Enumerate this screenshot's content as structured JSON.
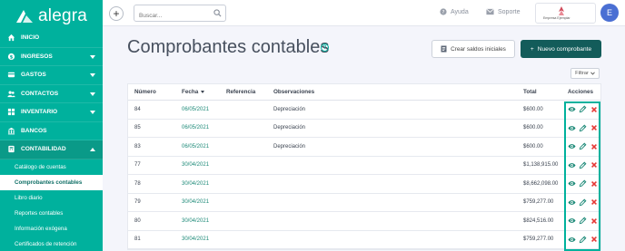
{
  "brand": {
    "name": "alegra"
  },
  "sidebar": {
    "items": [
      {
        "label": "INICIO",
        "icon": "home-icon",
        "has_chevron": false
      },
      {
        "label": "INGRESOS",
        "icon": "income-icon",
        "has_chevron": true
      },
      {
        "label": "GASTOS",
        "icon": "expense-icon",
        "has_chevron": true
      },
      {
        "label": "CONTACTOS",
        "icon": "contacts-icon",
        "has_chevron": true
      },
      {
        "label": "INVENTARIO",
        "icon": "inventory-icon",
        "has_chevron": true
      },
      {
        "label": "BANCOS",
        "icon": "bank-icon",
        "has_chevron": false
      },
      {
        "label": "CONTABILIDAD",
        "icon": "accounting-icon",
        "has_chevron": true,
        "open": true
      }
    ],
    "subitems": [
      {
        "label": "Catálogo de cuentas",
        "active": false
      },
      {
        "label": "Comprobantes contables",
        "active": true
      },
      {
        "label": "Libro diario",
        "active": false
      },
      {
        "label": "Reportes contables",
        "active": false
      },
      {
        "label": "Información exógena",
        "active": false
      },
      {
        "label": "Certificados de retención",
        "active": false
      }
    ]
  },
  "topbar": {
    "add_label": "+",
    "search_placeholder": "Buscar...",
    "help_label": "Ayuda",
    "support_label": "Soporte",
    "company_name": "Empresa Ejemplar",
    "avatar_initial": "E"
  },
  "page": {
    "title": "Comprobantes contables",
    "help_symbol": "?",
    "btn_saldos": "Crear saldos iniciales",
    "btn_nuevo": "Nuevo comprobante",
    "btn_nuevo_prefix": "+",
    "btn_filtrar": "Filtrar"
  },
  "table": {
    "headers": {
      "numero": "Número",
      "fecha": "Fecha",
      "referencia": "Referencia",
      "observaciones": "Observaciones",
      "total": "Total",
      "acciones": "Acciones"
    },
    "rows": [
      {
        "numero": "84",
        "fecha": "06/05/2021",
        "referencia": "",
        "observaciones": "Depreciación",
        "total": "$600.00"
      },
      {
        "numero": "85",
        "fecha": "06/05/2021",
        "referencia": "",
        "observaciones": "Depreciación",
        "total": "$600.00"
      },
      {
        "numero": "83",
        "fecha": "06/05/2021",
        "referencia": "",
        "observaciones": "Depreciación",
        "total": "$600.00"
      },
      {
        "numero": "77",
        "fecha": "30/04/2021",
        "referencia": "",
        "observaciones": "",
        "total": "$1,138,915.00"
      },
      {
        "numero": "78",
        "fecha": "30/04/2021",
        "referencia": "",
        "observaciones": "",
        "total": "$8,662,098.00"
      },
      {
        "numero": "79",
        "fecha": "30/04/2021",
        "referencia": "",
        "observaciones": "",
        "total": "$759,277.00"
      },
      {
        "numero": "80",
        "fecha": "30/04/2021",
        "referencia": "",
        "observaciones": "",
        "total": "$824,516.00"
      },
      {
        "numero": "81",
        "fecha": "30/04/2021",
        "referencia": "",
        "observaciones": "",
        "total": "$759,277.00"
      }
    ]
  },
  "colors": {
    "brand": "#00b19d",
    "brand_dark": "#135c5a",
    "link": "#1d8a78",
    "delete": "#e53935",
    "avatar": "#4a6fd3"
  }
}
